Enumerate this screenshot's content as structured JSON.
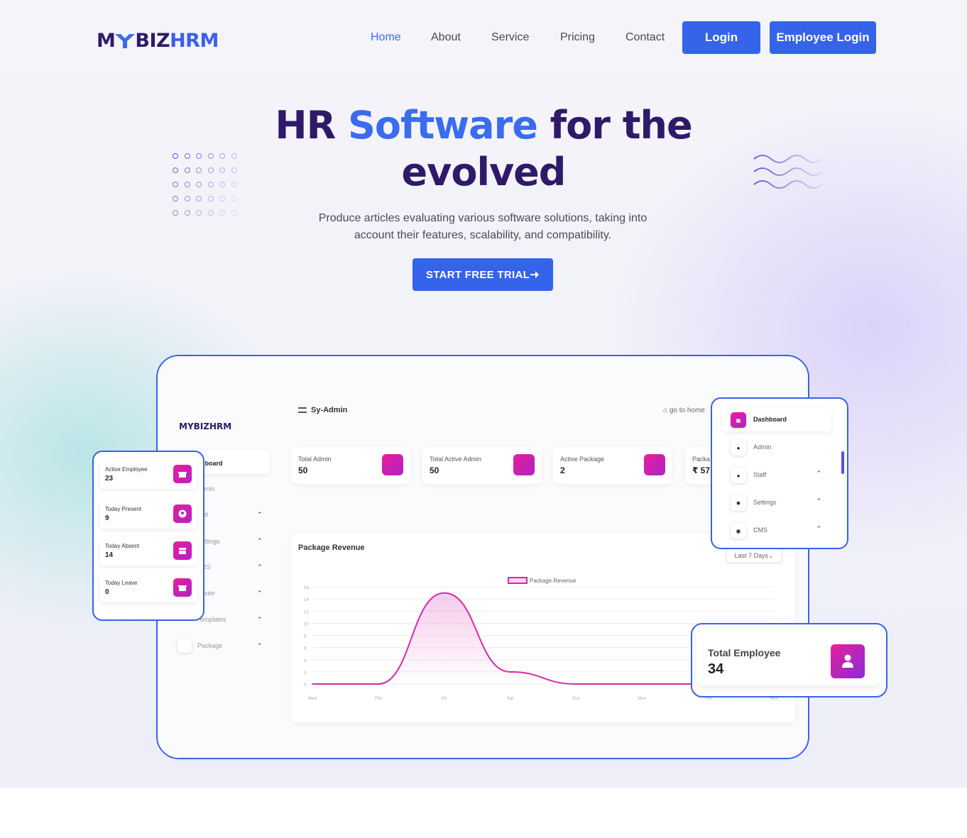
{
  "brand": {
    "logo_m": "M",
    "logo_biz": "BIZ",
    "logo_hrm": "HRM"
  },
  "nav": {
    "links": [
      "Home",
      "About",
      "Service",
      "Pricing",
      "Contact"
    ],
    "active": "Home",
    "login": "Login",
    "employee_login": "Employee Login"
  },
  "hero": {
    "title_pre": "HR ",
    "title_accent": "Software",
    "title_post": " for the",
    "title_line2": "evolved",
    "subtitle_line1": "Produce articles evaluating various software solutions, taking into",
    "subtitle_line2": "account their features, scalability, and compatibility.",
    "cta": "START FREE TRIAL",
    "cta_icon": "arrow-right-icon"
  },
  "dashboard": {
    "logo": "MYBIZHRM",
    "topbar_title": "Sy-Admin",
    "goto_home": "go to home",
    "sidebar": [
      "shboard",
      "min",
      "ff",
      "ttings",
      "IS",
      "ster",
      "emplates",
      "Package"
    ],
    "stats": [
      {
        "label": "Total Admin",
        "value": "50"
      },
      {
        "label": "Total Active Admin",
        "value": "50"
      },
      {
        "label": "Active Package",
        "value": "2"
      },
      {
        "label": "Packa",
        "value": "₹ 57"
      }
    ],
    "revenue_title": "Package Revenue",
    "range": "Last 7 Days"
  },
  "chart_data": {
    "type": "line",
    "title": "Package Revenue",
    "series": [
      {
        "name": "Package Revenue",
        "values": [
          0,
          0,
          15,
          2,
          0,
          0,
          0,
          0
        ]
      }
    ],
    "categories": [
      "Wed",
      "Thu",
      "Fri",
      "Sat",
      "Sun",
      "Mon",
      "Tue",
      "Wed"
    ],
    "ylim": [
      0,
      16
    ],
    "yticks": [
      0,
      2,
      4,
      6,
      8,
      10,
      12,
      14,
      16
    ],
    "color": "#d42ba8"
  },
  "employee_stats": [
    {
      "label": "Active Employee",
      "value": "23"
    },
    {
      "label": "Today Present",
      "value": "9"
    },
    {
      "label": "Today Absent",
      "value": "14"
    },
    {
      "label": "Today Leave",
      "value": "0"
    }
  ],
  "menu": [
    {
      "label": "Dashboard",
      "icon": "store-icon",
      "active": true
    },
    {
      "label": "Admin",
      "icon": "user-icon"
    },
    {
      "label": "Staff",
      "icon": "users-icon"
    },
    {
      "label": "Settings",
      "icon": "gear-icon"
    },
    {
      "label": "CMS",
      "icon": "globe-icon"
    }
  ],
  "total_employee": {
    "label": "Total Employee",
    "value": "34"
  },
  "colors": {
    "primary": "#3563ea",
    "heading": "#2e1a68",
    "accent": "#3b6cf0",
    "pink": "#e5209a"
  }
}
